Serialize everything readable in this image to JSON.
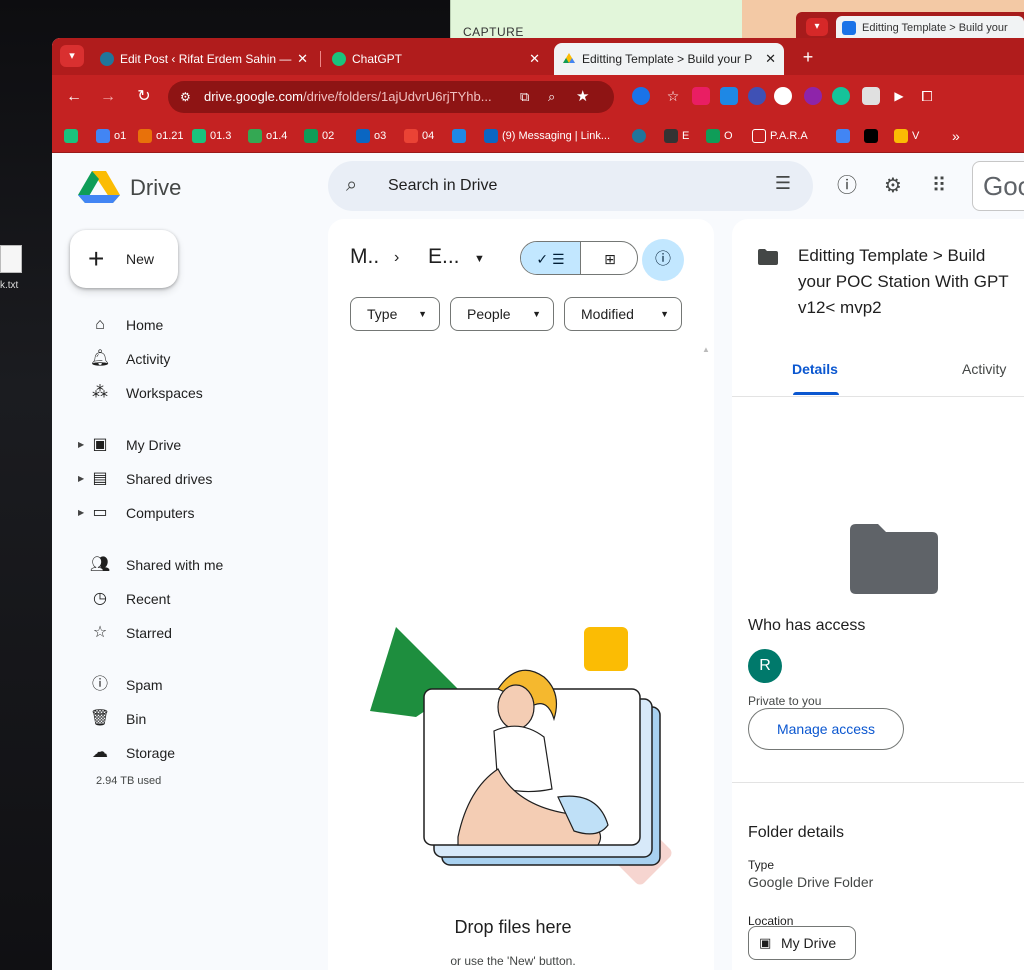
{
  "background": {
    "note_text": "CAPTURE",
    "chrome_tab_title": "Editting Template > Build your",
    "desktop_file_label": "k.txt"
  },
  "browser": {
    "tabs": [
      {
        "title": "Edit Post ‹ Rifat Erdem Sahin —",
        "icon": "wordpress-icon"
      },
      {
        "title": "ChatGPT",
        "icon": "chatgpt-icon"
      },
      {
        "title": "Editting Template > Build your P",
        "icon": "google-drive-icon",
        "active": true
      }
    ],
    "url_host": "drive.google.com",
    "url_path": "/drive/folders/1ajUdvrU6rjTYhb...",
    "bookmarks": [
      {
        "label": "",
        "color": "#19c37d"
      },
      {
        "label": "o1",
        "color": "#4285f4"
      },
      {
        "label": "o1.21",
        "color": "#e8710a"
      },
      {
        "label": "01.3",
        "color": "#19c37d"
      },
      {
        "label": "o1.4",
        "color": "#34a853"
      },
      {
        "label": "02",
        "color": "#0f9d58"
      },
      {
        "label": "o3",
        "color": "#0a66c2"
      },
      {
        "label": "04",
        "color": "#ea4335"
      },
      {
        "label": "",
        "color": "#1e88e5"
      },
      {
        "label": "(9) Messaging | Link...",
        "color": "#0a66c2"
      },
      {
        "label": "",
        "color": "#21759b"
      },
      {
        "label": "E",
        "color": "#333333"
      },
      {
        "label": "O",
        "color": "#0f9d58"
      },
      {
        "label": "P.A.R.A",
        "color": "#cccccc"
      },
      {
        "label": "",
        "color": "#4285f4"
      },
      {
        "label": "",
        "color": "#000000"
      },
      {
        "label": "V",
        "color": "#fbbc04"
      }
    ],
    "bookmarks_overflow": "»"
  },
  "app": {
    "brand": "Drive",
    "search_placeholder": "Search in Drive",
    "google_label": "Goo",
    "new_label": "New",
    "nav": [
      {
        "label": "Home",
        "icon": "home-icon"
      },
      {
        "label": "Activity",
        "icon": "bell-icon"
      },
      {
        "label": "Workspaces",
        "icon": "workspaces-icon"
      },
      {
        "label": "My Drive",
        "icon": "my-drive-icon"
      },
      {
        "label": "Shared drives",
        "icon": "shared-drives-icon"
      },
      {
        "label": "Computers",
        "icon": "computers-icon"
      },
      {
        "label": "Shared with me",
        "icon": "people-icon"
      },
      {
        "label": "Recent",
        "icon": "clock-icon"
      },
      {
        "label": "Starred",
        "icon": "star-icon"
      },
      {
        "label": "Spam",
        "icon": "spam-icon"
      },
      {
        "label": "Bin",
        "icon": "trash-icon"
      },
      {
        "label": "Storage",
        "icon": "cloud-icon"
      }
    ],
    "storage_used": "2.94 TB used"
  },
  "main": {
    "breadcrumb_parent": "M..",
    "breadcrumb_current": "E...",
    "filters": [
      "Type",
      "People",
      "Modified"
    ],
    "drop_title": "Drop files here",
    "drop_subtitle": "or use the 'New' button."
  },
  "details": {
    "title": "Editting Template > Build your POC Station With GPT v12< mvp2",
    "tabs": [
      "Details",
      "Activity"
    ],
    "who_has_access": "Who has access",
    "avatar_letter": "R",
    "private_text": "Private to you",
    "manage_access": "Manage access",
    "folder_details": "Folder details",
    "type_label": "Type",
    "type_value": "Google Drive Folder",
    "location_label": "Location",
    "location_value": "My Drive"
  },
  "colors": {
    "browser_frame": "#c42222",
    "accent_blue": "#0b57d0",
    "selected_chip": "#c2e7ff",
    "avatar": "#00796b"
  }
}
